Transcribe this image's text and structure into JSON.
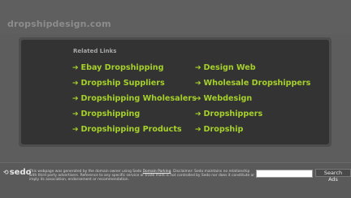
{
  "header": {
    "site_title": "dropshipdesign.com"
  },
  "related": {
    "title": "Related Links",
    "left_links": [
      {
        "label": "Ebay Dropshipping"
      },
      {
        "label": "Dropship Suppliers"
      },
      {
        "label": "Dropshipping Wholesalers"
      },
      {
        "label": "Dropshipping"
      },
      {
        "label": "Dropshipping Products"
      }
    ],
    "right_links": [
      {
        "label": "Design Web"
      },
      {
        "label": "Wholesale Dropshippers"
      },
      {
        "label": "Webdesign"
      },
      {
        "label": "Dropshippers"
      },
      {
        "label": "Dropship"
      }
    ],
    "arrow": "➔"
  },
  "footer": {
    "logo_text": "sedo",
    "disclaimer_before": "This webpage was generated by the domain owner using Sedo",
    "disclaimer_link": "Domain Parking",
    "disclaimer_after": ". Disclaimer: Sedo maintains no relationship with third party advertisers. Reference to any specific service or trade mark is not controlled by Sedo nor does it constitute or imply its association, endorsement or recommendation.",
    "search_placeholder": "",
    "search_button": "Search Ads"
  },
  "colors": {
    "background": "#5d5d5d",
    "panel": "#333333",
    "link": "#a6d12a"
  }
}
